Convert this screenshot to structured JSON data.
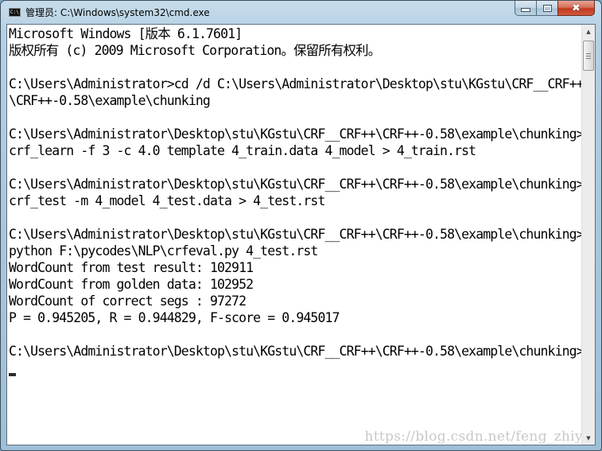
{
  "window": {
    "title": "管理员: C:\\Windows\\system32\\cmd.exe",
    "app_icon": "cmd-icon",
    "app_icon_label": "C:\\",
    "buttons": {
      "minimize": "minimize-icon",
      "maximize": "maximize-icon",
      "close": "close-icon",
      "close_glyph": "✖"
    }
  },
  "console": {
    "lines": [
      "Microsoft Windows [版本 6.1.7601]",
      "版权所有 (c) 2009 Microsoft Corporation。保留所有权利。",
      "",
      "C:\\Users\\Administrator>cd /d C:\\Users\\Administrator\\Desktop\\stu\\KGstu\\CRF__CRF++",
      "\\CRF++-0.58\\example\\chunking",
      "",
      "C:\\Users\\Administrator\\Desktop\\stu\\KGstu\\CRF__CRF++\\CRF++-0.58\\example\\chunking>",
      "crf_learn -f 3 -c 4.0 template 4_train.data 4_model > 4_train.rst",
      "",
      "C:\\Users\\Administrator\\Desktop\\stu\\KGstu\\CRF__CRF++\\CRF++-0.58\\example\\chunking>",
      "crf_test -m 4_model 4_test.data > 4_test.rst",
      "",
      "C:\\Users\\Administrator\\Desktop\\stu\\KGstu\\CRF__CRF++\\CRF++-0.58\\example\\chunking>",
      "python F:\\pycodes\\NLP\\crfeval.py 4_test.rst",
      "WordCount from test result: 102911",
      "WordCount from golden data: 102952",
      "WordCount of correct segs : 97272",
      "P = 0.945205, R = 0.944829, F-score = 0.945017",
      "",
      "C:\\Users\\Administrator\\Desktop\\stu\\KGstu\\CRF__CRF++\\CRF++-0.58\\example\\chunking>"
    ],
    "results": {
      "wordcount_test_result": 102911,
      "wordcount_golden_data": 102952,
      "wordcount_correct_segs": 97272,
      "precision": 0.945205,
      "recall": 0.944829,
      "f_score": 0.945017
    }
  },
  "scrollbar": {
    "up_glyph": "▲",
    "down_glyph": "▼"
  },
  "watermark": "https://blog.csdn.net/feng_zhiyu"
}
